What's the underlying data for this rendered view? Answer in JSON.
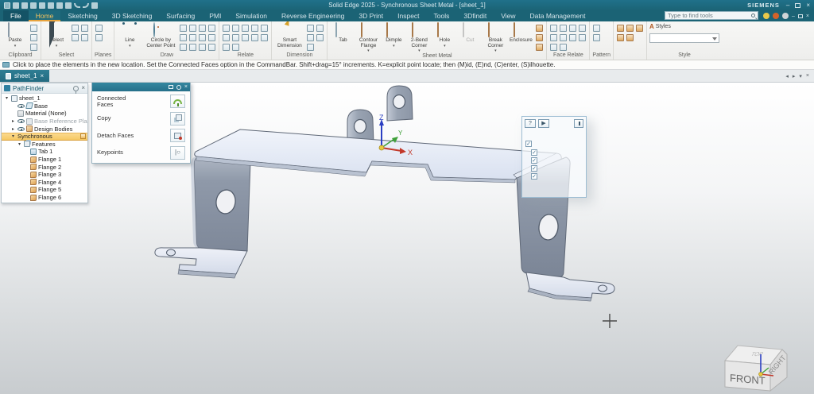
{
  "window": {
    "title": "Solid Edge 2025 - Synchronous Sheet Metal - [sheet_1]",
    "brand": "SIEMENS",
    "controls": {
      "minimize": "–",
      "close": "×"
    },
    "quick_access_icons": [
      "app-icon",
      "new-document-icon",
      "open-icon",
      "save-icon",
      "save-as-icon",
      "print-icon",
      "settings-icon",
      "properties-icon",
      "undo-icon",
      "redo-icon",
      "repeat-icon"
    ]
  },
  "menu": {
    "tabs": [
      "File",
      "Home",
      "Sketching",
      "3D Sketching",
      "Surfacing",
      "PMI",
      "Simulation",
      "Reverse Engineering",
      "3D Print",
      "Inspect",
      "Tools",
      "3Dfindit",
      "View",
      "Data Management"
    ],
    "active_tab": "Home",
    "search_placeholder": "Type to find tools",
    "right_icons": [
      "community-icon",
      "support-icon",
      "help-icon"
    ]
  },
  "ribbon": {
    "arrow_glyph": "▾",
    "groups": {
      "clipboard": {
        "label": "Clipboard",
        "paste": "Paste",
        "icons": [
          "copy-icon",
          "clipboard-icon",
          "format-painter-icon"
        ]
      },
      "select": {
        "label": "Select",
        "select": "Select",
        "icons": [
          "select-options-icon",
          "fence-select-icon",
          "deselect-icon",
          "select-priority-icon"
        ]
      },
      "planes": {
        "label": "Planes",
        "icons": [
          "coincident-plane-icon",
          "more-planes-icon"
        ]
      },
      "draw": {
        "label": "Draw",
        "line": "Line",
        "circle": "Circle by\nCenter Point",
        "icons": [
          "rectangle-icon",
          "arc-icon",
          "fillet-icon",
          "offset-icon",
          "project-to-sketch-icon",
          "pattern-sketch-icon",
          "trim-icon",
          "extend-icon",
          "split-icon",
          "move-icon",
          "rotate-icon",
          "pencil-icon"
        ]
      },
      "relate": {
        "label": "Relate",
        "icons": [
          "connect-icon",
          "horizontal-vertical-icon",
          "tangent-icon",
          "lock-icon",
          "parallel-icon",
          "equal-icon",
          "symmetric-icon",
          "concentric-icon",
          "collinear-icon",
          "rigid-set-icon",
          "maintain-relationships-icon",
          "relationship-colors-icon"
        ]
      },
      "dimension": {
        "label": "Dimension",
        "smart": "Smart\nDimension",
        "icons": [
          "distance-between-icon",
          "angle-between-icon",
          "symmetric-diameter-icon",
          "coordinate-dimension-icon",
          "dimension-style-icon"
        ]
      },
      "sheet_metal": {
        "label": "Sheet Metal",
        "buttons": [
          {
            "label": "Tab",
            "icon": "tab-icon",
            "arrow": false,
            "disabled": false,
            "flat": true
          },
          {
            "label": "Contour Flange",
            "icon": "contour-flange-icon",
            "arrow": true,
            "disabled": false
          },
          {
            "label": "Dimple",
            "icon": "dimple-icon",
            "arrow": true,
            "disabled": false
          },
          {
            "label": "2-Bend Corner",
            "icon": "two-bend-corner-icon",
            "arrow": true,
            "disabled": false
          },
          {
            "label": "Hole",
            "icon": "hole-icon",
            "arrow": true,
            "disabled": false
          },
          {
            "label": "Cut",
            "icon": "cut-icon",
            "arrow": false,
            "disabled": true
          },
          {
            "label": "Break Corner",
            "icon": "break-corner-icon",
            "arrow": true,
            "disabled": false
          },
          {
            "label": "Enclosure",
            "icon": "enclosure-icon",
            "arrow": false,
            "disabled": false
          }
        ],
        "icons": [
          "copy-face-icon",
          "paste-face-icon",
          "detach-icon"
        ]
      },
      "face_relate": {
        "label": "Face Relate",
        "icons": [
          "relate-faces-icon",
          "keep-relationships-icon",
          "symmetry-face-icon",
          "coplanar-icon",
          "parallel-face-icon",
          "perpendicular-face-icon",
          "offset-face-icon",
          "horizontal-face-icon",
          "tangent-face-icon",
          "lock-face-icon"
        ]
      },
      "pattern": {
        "label": "Pattern",
        "icons": [
          "rectangular-pattern-icon",
          "mirror-icon"
        ]
      },
      "body": {
        "label": "",
        "icons": [
          "add-body-icon",
          "subtract-body-icon",
          "intersect-body-icon",
          "multi-body-icon",
          "split-body-icon"
        ]
      },
      "style": {
        "label": "Style",
        "styles_label": "Styles",
        "style_value": ""
      }
    }
  },
  "prompt": {
    "text": "Click to place the elements in the new location.  Set the Connected Faces option in the CommandBar.  Shift+drag=15° increments.  K=explicit point locate; then (M)id, (E)nd, (C)enter, (S)ilhouette."
  },
  "document_tabs": {
    "active": "sheet_1",
    "close_glyph": "×",
    "nav_prev": "◂",
    "nav_next": "▸",
    "nav_menu": "▾",
    "nav_close": "×"
  },
  "pathfinder": {
    "title": "PathFinder",
    "expander_glyphs": {
      "open": "▾",
      "closed": "▸"
    },
    "items": [
      {
        "label": "sheet_1",
        "level": 0,
        "expander": "open",
        "icon": "document"
      },
      {
        "label": "Base",
        "level": 1,
        "expander": null,
        "eye": true,
        "icon": "base-plane"
      },
      {
        "label": "Material (None)",
        "level": 1,
        "expander": null,
        "icon": "material"
      },
      {
        "label": "Base Reference Planes",
        "level": 1,
        "expander": "closed",
        "eye": true,
        "icon": "ref-planes",
        "dim": true
      },
      {
        "label": "Design Bodies",
        "level": 1,
        "expander": "closed",
        "eye": true,
        "icon": "design-bodies"
      },
      {
        "label": "Synchronous",
        "level": 1,
        "expander": "open",
        "icon": null,
        "highlight": true
      },
      {
        "label": "Features",
        "level": 2,
        "expander": "open",
        "icon": "features"
      },
      {
        "label": "Tab 1",
        "level": 3,
        "expander": null,
        "icon": "tab"
      },
      {
        "label": "Flange 1",
        "level": 3,
        "expander": null,
        "icon": "flange"
      },
      {
        "label": "Flange 2",
        "level": 3,
        "expander": null,
        "icon": "flange"
      },
      {
        "label": "Flange 3",
        "level": 3,
        "expander": null,
        "icon": "flange"
      },
      {
        "label": "Flange 4",
        "level": 3,
        "expander": null,
        "icon": "flange"
      },
      {
        "label": "Flange 5",
        "level": 3,
        "expander": null,
        "icon": "flange"
      },
      {
        "label": "Flange 6",
        "level": 3,
        "expander": null,
        "icon": "flange"
      }
    ]
  },
  "command_panel": {
    "items": [
      {
        "label": "Connected\nFaces",
        "icon": "connected-faces"
      },
      {
        "label": "Copy",
        "icon": "copy"
      },
      {
        "label": "Detach Faces",
        "icon": "detach-faces"
      },
      {
        "label": "Keypoints",
        "icon": "keypoints"
      }
    ]
  },
  "quickbar": {
    "help": "?",
    "play": "▶",
    "check_glyph": "✓",
    "checkbox_count": 5
  },
  "viewport": {
    "triad": {
      "x": "X",
      "y": "Y",
      "z": "Z"
    },
    "view_cube": {
      "front": "FRONT",
      "right": "RIGHT",
      "top": "TOP"
    }
  },
  "colors": {
    "titlebar": "#1b6375",
    "accent_orange": "#e8a33d",
    "highlight_row": "#f6c964",
    "tab_teal": "#26708a",
    "part_gray": "#8a94a5",
    "part_light": "#e3e9f5",
    "axis_x": "#c2392b",
    "axis_y": "#3fa03a",
    "axis_z": "#2b3fc2"
  }
}
